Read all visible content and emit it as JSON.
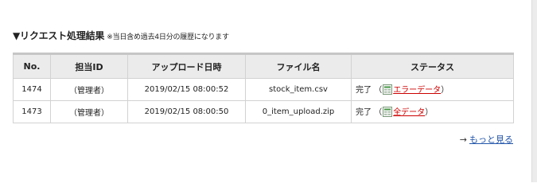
{
  "section": {
    "title": "▼リクエスト処理結果",
    "note": "※当日含め過去4日分の履歴になります"
  },
  "table": {
    "headers": [
      "No.",
      "担当ID",
      "アップロード日時",
      "ファイル名",
      "ステータス"
    ],
    "rows": [
      {
        "no": "1474",
        "user": "（管理者）",
        "datetime": "2019/02/15 08:00:52",
        "filename": "stock_item.csv",
        "status": "完了",
        "open_paren": "（",
        "link_label": "エラーデータ",
        "close_paren": "）"
      },
      {
        "no": "1473",
        "user": "（管理者）",
        "datetime": "2019/02/15 08:00:50",
        "filename": "0_item_upload.zip",
        "status": "完了",
        "open_paren": "（",
        "link_label": "全データ",
        "close_paren": "）"
      }
    ]
  },
  "more": {
    "arrow": "→",
    "label": "もっと見る"
  },
  "icons": {
    "row_file_icon": "spreadsheet-file-icon"
  },
  "colors": {
    "link_red": "#cc0000",
    "link_blue": "#2255aa",
    "header_bg": "#ebebeb"
  }
}
